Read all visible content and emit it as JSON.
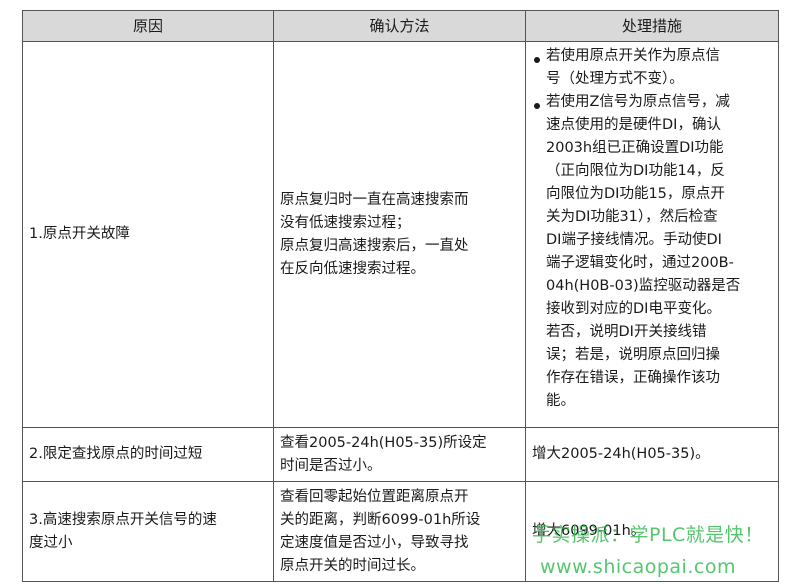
{
  "table": {
    "headers": [
      "原因",
      "确认方法",
      "处理措施"
    ],
    "rows": [
      {
        "cause": "1.原点开关故障",
        "method_lines": [
          "原点复归时一直在高速搜索而",
          "没有低速搜索过程；",
          "原点复归高速搜索后，一直处",
          "在反向低速搜索过程。"
        ],
        "measure_items": [
          [
            "若使用原点开关作为原点信",
            "号（处理方式不变）。"
          ],
          [
            "若使用Z信号为原点信号，减",
            "速点使用的是硬件DI，确认",
            "2003h组已正确设置DI功能",
            "（正向限位为DI功能14，反",
            "向限位为DI功能15，原点开",
            "关为DI功能31），然后检查",
            "DI端子接线情况。手动使DI",
            "端子逻辑变化时，通过200B-",
            "04h(H0B-03)监控驱动器是否",
            "接收到对应的DI电平变化。",
            "若否，说明DI开关接线错",
            "误；若是，说明原点回归操",
            "作存在错误，正确操作该功",
            "能。"
          ]
        ]
      },
      {
        "cause": "2.限定查找原点的时间过短",
        "method_lines": [
          "查看2005-24h(H05-35)所设定",
          "时间是否过小。"
        ],
        "measure": "增大2005-24h(H05-35)。"
      },
      {
        "cause_lines": [
          "3.高速搜索原点开关信号的速",
          "度过小"
        ],
        "method_lines": [
          "查看回零起始位置距离原点开",
          "关的距离，判断6099-01h所设",
          "定速度值是否过小，导致寻找",
          "原点开关的时间过长。"
        ],
        "measure": "增大6099-01h。"
      }
    ]
  },
  "watermark": {
    "line1": "手实操派：学PLC就是快！",
    "line2": "www.shicaopai.com",
    "color": "#2db84b"
  }
}
